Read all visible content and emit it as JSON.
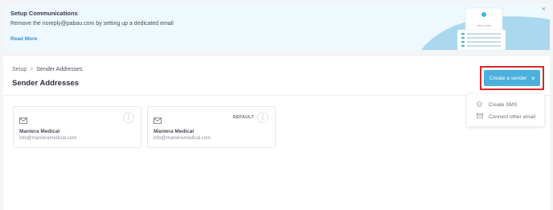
{
  "banner": {
    "title": "Setup Communications",
    "text": "Remove the noreply@pabau.com by setting up a dedicated email",
    "link": "Read More",
    "close": "×",
    "illustration_label": "View Only"
  },
  "breadcrumb": {
    "items": [
      "Setup",
      "Sender Addresses"
    ],
    "separator": ">"
  },
  "page_title": "Sender Addresses",
  "create_button": {
    "label": "Create a sender",
    "chevron": "∨"
  },
  "dropdown": {
    "items": [
      {
        "label": "Create SMS",
        "icon": "chat-icon"
      },
      {
        "label": "Connect other email",
        "icon": "mail-icon"
      }
    ]
  },
  "cards": [
    {
      "name": "Maniera Medical",
      "email": "info@manieramedical.com",
      "badge": ""
    },
    {
      "name": "Maniera Medical",
      "email": "info@manieramedical.com",
      "badge": "DEFAULT"
    }
  ],
  "colors": {
    "accent": "#4bb0dc",
    "highlight": "#d42a2a",
    "banner_bg": "#eef8fd",
    "wave": "#a9d8ef"
  }
}
